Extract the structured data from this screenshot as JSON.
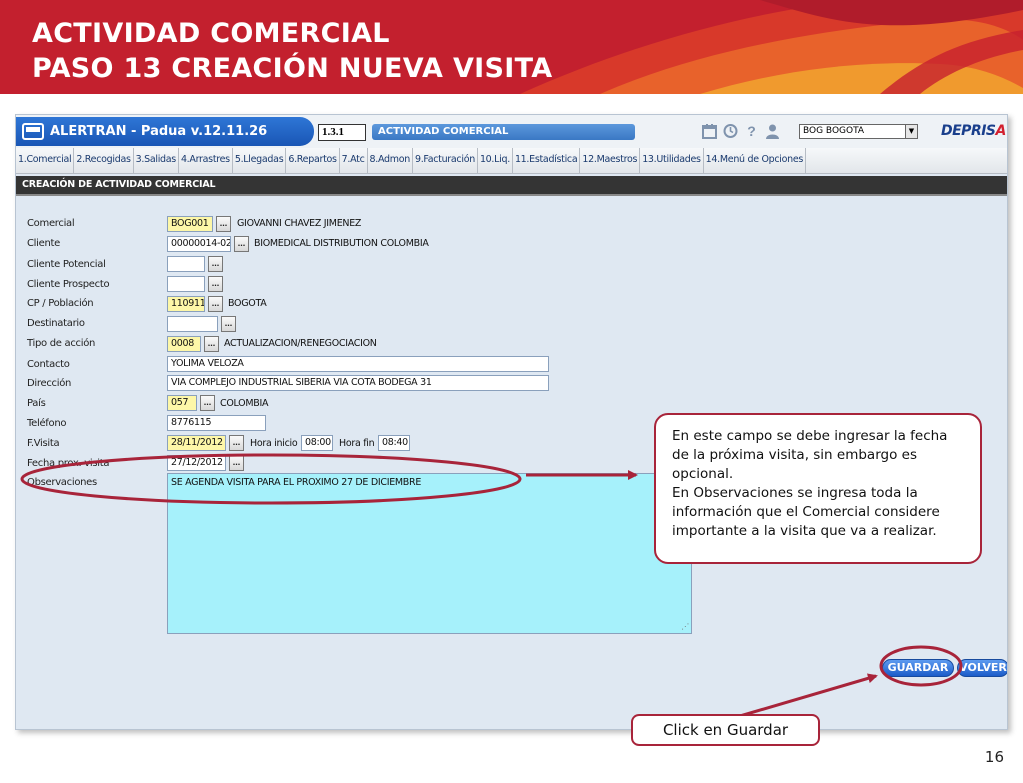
{
  "slide": {
    "title_line1": "ACTIVIDAD COMERCIAL",
    "title_line2": "PASO 13 CREACIÓN NUEVA VISITA",
    "page_number": "16"
  },
  "app": {
    "title": "ALERTRAN - Padua  v.12.11.26",
    "version_code": "1.3.1",
    "module_name": "ACTIVIDAD COMERCIAL",
    "office_selected": "BOG BOGOTA",
    "logo": "DEPRISA",
    "icons": [
      "calendar-icon",
      "clock-icon",
      "help-icon",
      "user-icon"
    ]
  },
  "menu": [
    "1.Comercial",
    "2.Recogidas",
    "3.Salidas",
    "4.Arrastres",
    "5.Llegadas",
    "6.Repartos",
    "7.Atc",
    "8.Admon",
    "9.Facturación",
    "10.Liq.",
    "11.Estadística",
    "12.Maestros",
    "13.Utilidades",
    "14.Menú de Opciones"
  ],
  "section_title": "CREACIÓN DE ACTIVIDAD COMERCIAL",
  "form": {
    "labels": {
      "comercial": "Comercial",
      "cliente": "Cliente",
      "cliente_potencial": "Cliente Potencial",
      "cliente_prospecto": "Cliente Prospecto",
      "cp_poblacion": "CP / Población",
      "destinatario": "Destinatario",
      "tipo_accion": "Tipo de acción",
      "contacto": "Contacto",
      "direccion": "Dirección",
      "pais": "País",
      "telefono": "Teléfono",
      "f_visita": "F.Visita",
      "hora_inicio": "Hora inicio",
      "hora_fin": "Hora fin",
      "fecha_prox_visita": "Fecha prox. visita",
      "observaciones": "Observaciones"
    },
    "values": {
      "comercial_code": "BOG001",
      "comercial_name": "GIOVANNI CHAVEZ JIMENEZ",
      "cliente_code": "00000014-02",
      "cliente_name": "BIOMEDICAL DISTRIBUTION COLOMBIA",
      "cliente_potencial": "",
      "cliente_prospecto": "",
      "cp_code": "110911",
      "cp_name": "BOGOTA",
      "destinatario": "",
      "tipo_accion_code": "0008",
      "tipo_accion_name": "ACTUALIZACION/RENEGOCIACION",
      "contacto": "YOLIMA VELOZA",
      "direccion": "VIA COMPLEJO INDUSTRIAL SIBERIA VIA COTA BODEGA 31",
      "pais_code": "057",
      "pais_name": "COLOMBIA",
      "telefono": "8776115",
      "f_visita": "28/11/2012",
      "hora_inicio": "08:00",
      "hora_fin": "08:40",
      "fecha_prox_visita": "27/12/2012",
      "observaciones": "SE AGENDA VISITA PARA EL PROXIMO 27 DE DICIEMBRE"
    },
    "lookup_label": "...",
    "buttons": {
      "save": "GUARDAR",
      "back": "VOLVER"
    }
  },
  "annotations": {
    "callout_text": "En este campo se debe ingresar la fecha de la próxima visita, sin embargo es opcional.\nEn Observaciones se ingresa toda la información que el Comercial considere importante  a la visita que va a realizar.",
    "click_note": "Click en Guardar",
    "highlight_color": "#a8243a"
  }
}
